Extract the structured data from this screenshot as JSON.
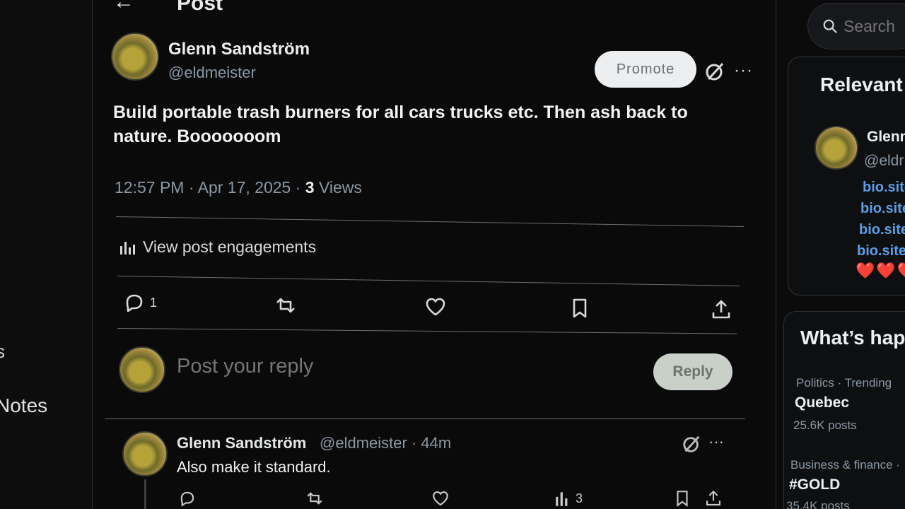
{
  "header": {
    "back_glyph": "←",
    "title": "Post"
  },
  "left_nav": {
    "notes_label": "Notes",
    "partial_item": "s"
  },
  "post": {
    "author_name": "Glenn Sandström",
    "author_handle": "@eldmeister",
    "promote_label": "Promote",
    "more_glyph": "···",
    "text": "Build portable trash burners for all cars trucks etc. Then ash back to nature. Booooooom",
    "time": "12:57 PM · Apr 17, 2025 · ",
    "views_count": "3",
    "views_label": " Views",
    "engagements_label": "View post engagements",
    "actions": {
      "reply_count": "1"
    }
  },
  "reply_composer": {
    "placeholder": "Post your reply",
    "reply_button": "Reply"
  },
  "child_post": {
    "author_name": "Glenn Sandström",
    "handle_time": "@eldmeister · 44m",
    "text": "Also make it standard.",
    "more_glyph": "···",
    "views_count": "3"
  },
  "search": {
    "placeholder": "Search"
  },
  "relevant": {
    "title": "Relevant",
    "name": "Glenn",
    "handle": "@eldr",
    "bio_links": [
      "bio.site",
      "bio.site",
      "bio.site",
      "bio.site"
    ],
    "hearts": "❤️❤️❤️"
  },
  "trends": {
    "title": "What’s hap",
    "items": [
      {
        "meta": "Politics · Trending",
        "name": "Quebec",
        "count": "25.6K posts"
      },
      {
        "meta": "Business & finance ·",
        "name": "#GOLD",
        "count": "35.4K posts"
      }
    ]
  },
  "colors": {
    "link": "#5b9ee8",
    "muted": "#8b98a5",
    "background": "#0a0a0b",
    "heart": "#d93a3a"
  }
}
